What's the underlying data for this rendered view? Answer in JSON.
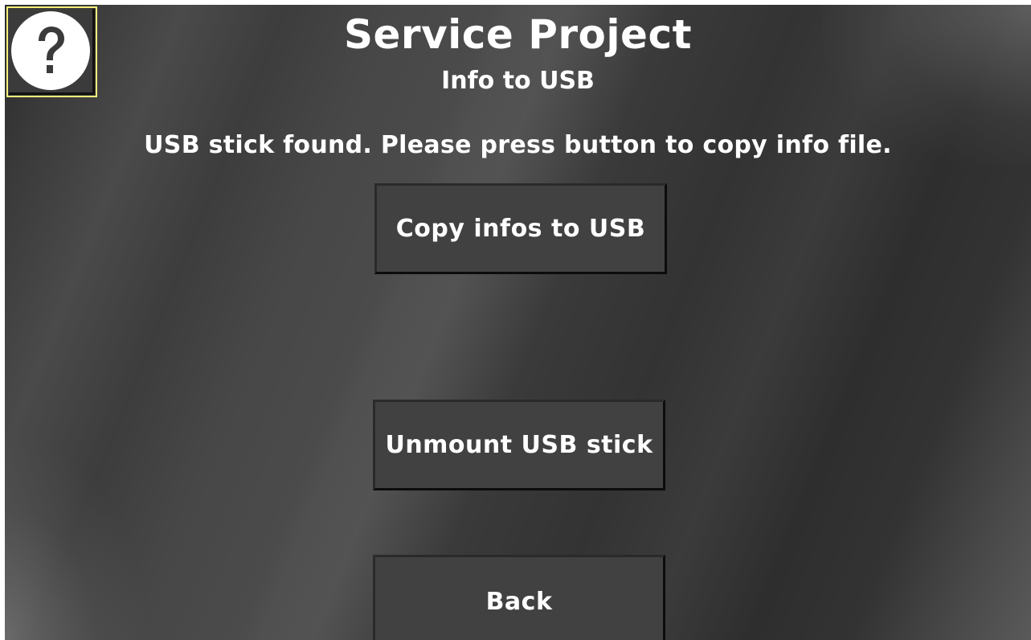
{
  "header": {
    "title": "Service Project",
    "subtitle": "Info to USB"
  },
  "status": {
    "message": "USB stick found. Please press button to copy info file."
  },
  "buttons": {
    "help_icon": "help-question-icon",
    "copy_label": "Copy infos to USB",
    "unmount_label": "Unmount USB stick",
    "back_label": "Back"
  },
  "colors": {
    "help_border": "#f5f07a",
    "button_fill": "#414141",
    "text": "#ffffff"
  }
}
